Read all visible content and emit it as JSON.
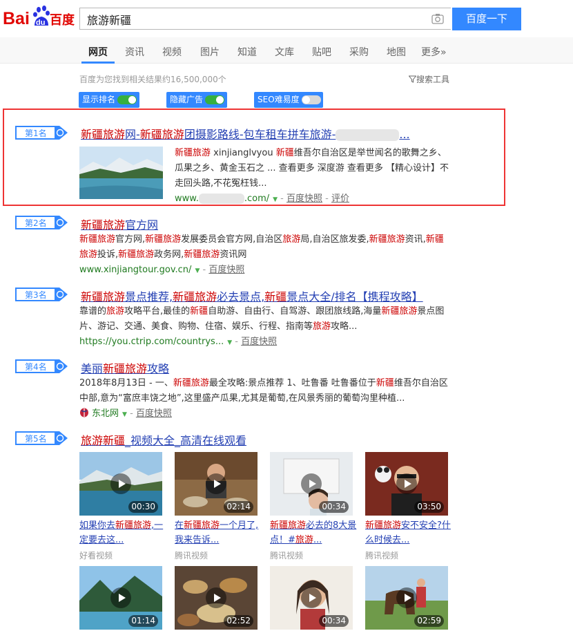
{
  "header": {
    "logo_text_1": "Bai",
    "logo_text_2": "du",
    "logo_text_3": "百度",
    "search_value": "旅游新疆",
    "search_button": "百度一下"
  },
  "tabs": [
    "网页",
    "资讯",
    "视频",
    "图片",
    "知道",
    "文库",
    "贴吧",
    "采购",
    "地图",
    "更多»"
  ],
  "toolbar": {
    "result_count": "百度为您找到相关结果约16,500,000个",
    "search_tools": "搜索工具",
    "toggles": [
      {
        "label": "显示排名",
        "on": true
      },
      {
        "label": "隐藏广告",
        "on": true
      },
      {
        "label": "SEO难易度",
        "on": false
      }
    ]
  },
  "colors": {
    "accent": "#3388ff",
    "highlight": "#c00000",
    "link": "#2440b3",
    "url_green": "#1f7a1f",
    "box_red": "#ee3333"
  },
  "results": [
    {
      "rank": "第1名",
      "title_parts": [
        [
          "新疆旅游",
          true
        ],
        [
          "网-",
          false
        ],
        [
          "新疆旅游",
          true
        ],
        [
          "团摄影路线-包车租车拼车旅游-",
          false
        ]
      ],
      "title_tail": "...",
      "abstract_parts": [
        [
          "新疆旅游",
          true
        ],
        [
          " xinjianglvyou ",
          false
        ],
        [
          "新疆",
          true
        ],
        [
          "维吾尔自治区是举世闻名的歌舞之乡、瓜果之乡、黄金玉石之 ... 查看更多 深度游 查看更多 【精心设计】不走回头路,不花冤枉钱...",
          false
        ]
      ],
      "url_prefix": "www.",
      "url_suffix": ".com/",
      "snapshot": "百度快照",
      "review": "评价"
    },
    {
      "rank": "第2名",
      "title_parts": [
        [
          "新疆旅游",
          true
        ],
        [
          "官方网",
          false
        ]
      ],
      "abstract_parts": [
        [
          "新疆旅游",
          true
        ],
        [
          "官方网,",
          false
        ],
        [
          "新疆旅游",
          true
        ],
        [
          "发展委员会官方网,自治区",
          false
        ],
        [
          "旅游",
          true
        ],
        [
          "局,自治区旅发委,",
          false
        ],
        [
          "新疆旅游",
          true
        ],
        [
          "资讯,",
          false
        ],
        [
          "新疆旅游",
          true
        ],
        [
          "投诉,",
          false
        ],
        [
          "新疆旅游",
          true
        ],
        [
          "政务网,",
          false
        ],
        [
          "新疆旅游",
          true
        ],
        [
          "资讯网",
          false
        ]
      ],
      "url": "www.xinjiangtour.gov.cn/",
      "snapshot": "百度快照"
    },
    {
      "rank": "第3名",
      "title_parts": [
        [
          "新疆旅游",
          true
        ],
        [
          "景点推荐,",
          false
        ],
        [
          "新疆旅游",
          true
        ],
        [
          "必去景点,",
          false
        ],
        [
          "新疆",
          true
        ],
        [
          "景点大全/排名【携程攻略】",
          false
        ]
      ],
      "abstract_parts": [
        [
          "靠谱的",
          false
        ],
        [
          "旅游",
          true
        ],
        [
          "攻略平台,最佳的",
          false
        ],
        [
          "新疆",
          true
        ],
        [
          "自助游、自由行、自驾游、跟团旅线路,海量",
          false
        ],
        [
          "新疆旅游",
          true
        ],
        [
          "景点图片、游记、交通、美食、购物、住宿、娱乐、行程、指南等",
          false
        ],
        [
          "旅游",
          true
        ],
        [
          "攻略...",
          false
        ]
      ],
      "url": "https://you.ctrip.com/countrys...",
      "snapshot": "百度快照"
    },
    {
      "rank": "第4名",
      "title_parts": [
        [
          "美丽",
          false
        ],
        [
          "新疆旅游",
          true
        ],
        [
          "攻略",
          false
        ]
      ],
      "abstract_parts": [
        [
          "2018年8月13日 - 一、",
          false
        ],
        [
          "新疆旅游",
          true
        ],
        [
          "最全攻略:景点推荐 1、吐鲁番 吐鲁番位于",
          false
        ],
        [
          "新疆",
          true
        ],
        [
          "维吾尔自治区中部,意为“富庶丰饶之地”,这里盛产瓜果,尤其是葡萄,在风景秀丽的葡萄沟里种植...",
          false
        ]
      ],
      "url": "东北网",
      "snapshot": "百度快照"
    },
    {
      "rank": "第5名",
      "title_parts": [
        [
          "旅游新疆",
          true
        ],
        [
          "_视频大全_高清在线观看",
          false
        ]
      ]
    }
  ],
  "videos": [
    {
      "duration": "00:30",
      "caption_parts": [
        [
          "如果你去",
          false
        ],
        [
          "新疆旅游",
          true
        ],
        [
          ",一定要去这...",
          false
        ]
      ],
      "source": "好看视频"
    },
    {
      "duration": "02:14",
      "caption_parts": [
        [
          "在",
          false
        ],
        [
          "新疆旅游",
          true
        ],
        [
          "一个月了,我来告诉...",
          false
        ]
      ],
      "source": "腾讯视频"
    },
    {
      "duration": "00:34",
      "caption_parts": [
        [
          "新疆旅游",
          true
        ],
        [
          "必去的8大景点！#",
          false
        ],
        [
          "旅游",
          true
        ],
        [
          "...",
          false
        ]
      ],
      "source": "腾讯视频"
    },
    {
      "duration": "03:50",
      "caption_parts": [
        [
          "新疆旅游",
          true
        ],
        [
          "安不安全?什么时候去...",
          false
        ]
      ],
      "source": "腾讯视频"
    },
    {
      "duration": "01:14"
    },
    {
      "duration": "02:52"
    },
    {
      "duration": "00:34"
    },
    {
      "duration": "02:59"
    }
  ]
}
